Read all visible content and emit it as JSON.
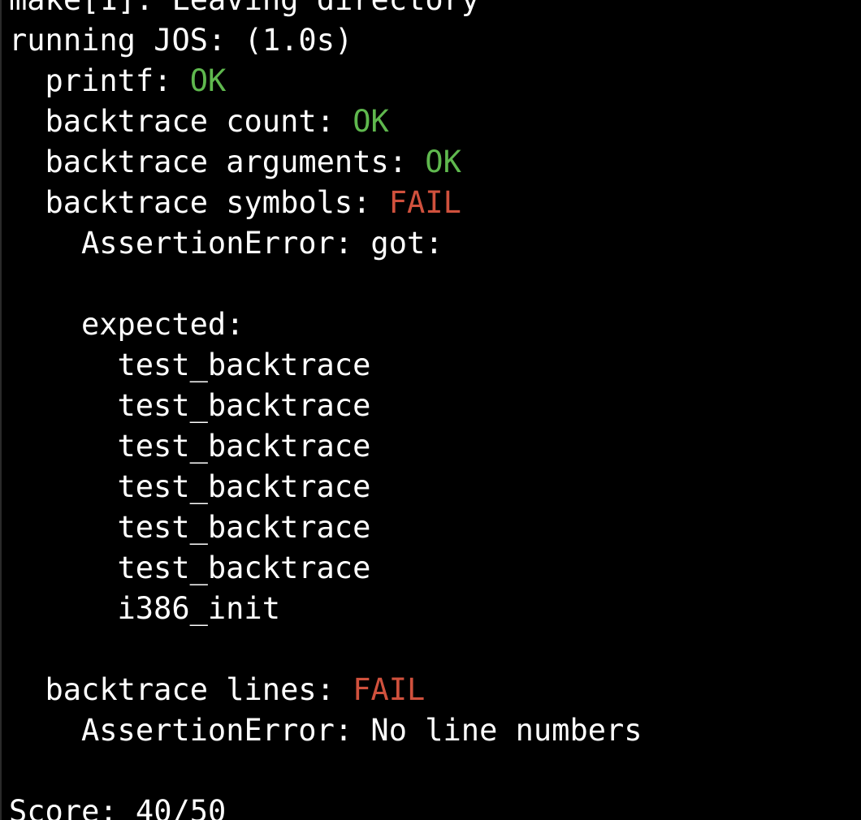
{
  "terminal": {
    "partial_top_line": "make[1]: Leaving directory",
    "run_header": "running JOS: (1.0s)",
    "tests": [
      {
        "label": "printf: ",
        "status": "OK"
      },
      {
        "label": "backtrace count: ",
        "status": "OK"
      },
      {
        "label": "backtrace arguments: ",
        "status": "OK"
      },
      {
        "label": "backtrace symbols: ",
        "status": "FAIL"
      }
    ],
    "symbols_error": "AssertionError: got:",
    "expected_header": "expected:",
    "expected_symbols": [
      "test_backtrace",
      "test_backtrace",
      "test_backtrace",
      "test_backtrace",
      "test_backtrace",
      "test_backtrace",
      "i386_init"
    ],
    "lines_test": {
      "label": "backtrace lines: ",
      "status": "FAIL"
    },
    "lines_error": "AssertionError: No line numbers",
    "score": "Score: 40/50"
  },
  "colors": {
    "background": "#000000",
    "text": "#ffffff",
    "ok": "#5fb84e",
    "fail": "#d0513d"
  }
}
